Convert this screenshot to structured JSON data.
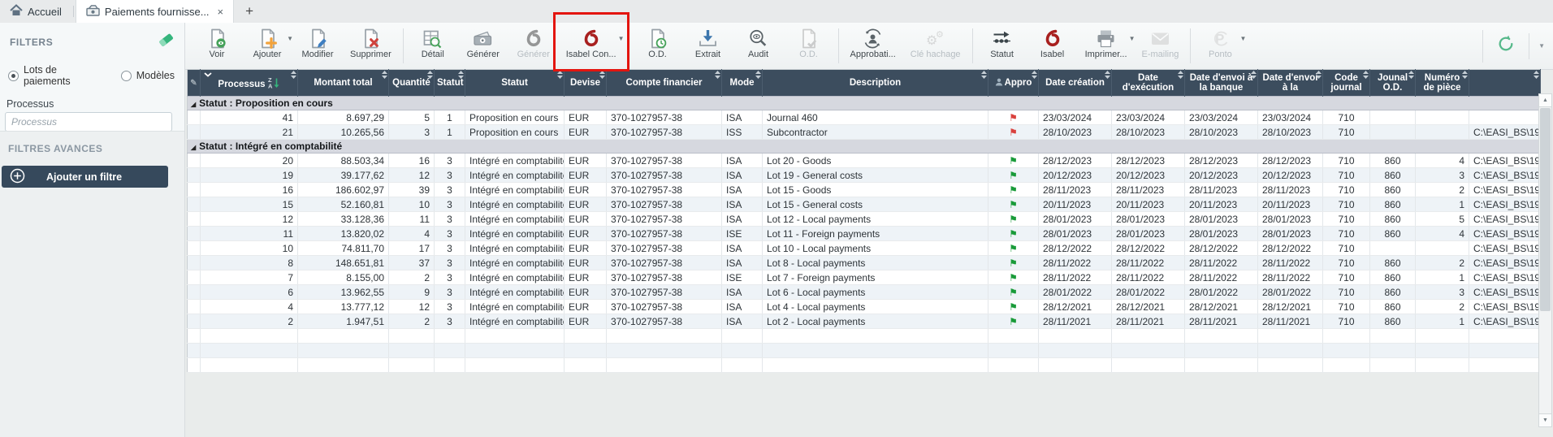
{
  "colors": {
    "annotation_red": "#e3150f",
    "flag_red": "#d9413d",
    "flag_green": "#199b39",
    "isabel_red": "#a8201f",
    "header_bg": "#3c4d5e",
    "sidebar_button_bg": "#36495c",
    "refresh_green": "#57b98b"
  },
  "tabs": {
    "home_label": "Accueil",
    "active_label": "Paiements fournisse...",
    "close_glyph": "×",
    "new_tab_glyph": "+"
  },
  "sidebar": {
    "title": "FILTERS",
    "radio_lots": "Lots de paiements",
    "radio_modeles": "Modèles",
    "processus_label": "Processus",
    "processus_placeholder": "Processus",
    "processus_value": "",
    "advanced_title": "FILTRES AVANCES",
    "add_filter_label": "Ajouter un filtre"
  },
  "toolbar": {
    "groups": [
      [
        {
          "name": "voir",
          "label": "Voir",
          "icon": "doc-eye",
          "enabled": true
        },
        {
          "name": "ajouter",
          "label": "Ajouter",
          "icon": "doc-plus",
          "enabled": true,
          "caret": true
        },
        {
          "name": "modifier",
          "label": "Modifier",
          "icon": "doc-pencil",
          "enabled": true
        },
        {
          "name": "supprimer",
          "label": "Supprimer",
          "icon": "doc-x",
          "enabled": true
        }
      ],
      [
        {
          "name": "detail",
          "label": "Détail",
          "icon": "grid-search",
          "enabled": true
        },
        {
          "name": "generer",
          "label": "Générer",
          "icon": "money",
          "enabled": true
        },
        {
          "name": "generer-isabel",
          "label": "Générer",
          "icon": "isabel-dark",
          "enabled": false
        },
        {
          "name": "isabel-connect",
          "label": "Isabel Con...",
          "icon": "isabel-red",
          "enabled": true,
          "caret": true,
          "highlighted": true
        }
      ],
      [
        {
          "name": "od",
          "label": "O.D.",
          "icon": "doc-clock",
          "enabled": true
        },
        {
          "name": "extrait",
          "label": "Extrait",
          "icon": "download",
          "enabled": true
        },
        {
          "name": "audit",
          "label": "Audit",
          "icon": "magnifier-eye",
          "enabled": true
        },
        {
          "name": "od-2",
          "label": "O.D.",
          "icon": "doc-check",
          "enabled": false
        }
      ],
      [
        {
          "name": "approbation",
          "label": "Approbati...",
          "icon": "person-sync",
          "enabled": true
        },
        {
          "name": "cle-hachage",
          "label": "Clé hachage",
          "icon": "gears",
          "enabled": false
        }
      ],
      [
        {
          "name": "statut",
          "label": "Statut",
          "icon": "flow-arrow",
          "enabled": true
        },
        {
          "name": "isabel",
          "label": "Isabel",
          "icon": "isabel-red",
          "enabled": true
        },
        {
          "name": "imprimer",
          "label": "Imprimer...",
          "icon": "printer",
          "enabled": true,
          "caret": true
        },
        {
          "name": "emailing",
          "label": "E-mailing",
          "icon": "envelope",
          "enabled": false
        }
      ],
      [
        {
          "name": "ponto",
          "label": "Ponto",
          "icon": "ponto",
          "enabled": false,
          "caret": true
        }
      ]
    ]
  },
  "table": {
    "columns": [
      {
        "name": "indicator",
        "label": ""
      },
      {
        "name": "processus",
        "label": "Processus"
      },
      {
        "name": "montant",
        "label": "Montant total"
      },
      {
        "name": "quantite",
        "label": "Quantité"
      },
      {
        "name": "statut_code",
        "label": "Statut"
      },
      {
        "name": "statut",
        "label": "Statut"
      },
      {
        "name": "devise",
        "label": "Devise"
      },
      {
        "name": "compte",
        "label": "Compte financier"
      },
      {
        "name": "mode",
        "label": "Mode"
      },
      {
        "name": "description",
        "label": "Description"
      },
      {
        "name": "appro",
        "label": "Appro"
      },
      {
        "name": "date_creation",
        "label": "Date création"
      },
      {
        "name": "date_execution",
        "label": "Date d'exécution"
      },
      {
        "name": "date_banque",
        "label": "Date d'envoi à la banque"
      },
      {
        "name": "date_envoi",
        "label": "Date d'envoi à la"
      },
      {
        "name": "code_journal",
        "label": "Code journal"
      },
      {
        "name": "jounal_od",
        "label": "Jounal O.D."
      },
      {
        "name": "piece",
        "label": "Numéro de pièce"
      },
      {
        "name": "path",
        "label": ""
      }
    ],
    "groups": [
      {
        "label": "Statut : Proposition en cours",
        "rows": [
          {
            "processus": "41",
            "montant": "8.697,29",
            "quantite": "5",
            "statut_code": "1",
            "statut": "Proposition en cours",
            "devise": "EUR",
            "compte": "370-1027957-38",
            "mode": "ISA",
            "description": "Journal 460",
            "flag": "red",
            "date": "23/03/2024",
            "code_journal": "710",
            "jounal_od": "",
            "piece": "",
            "path": ""
          },
          {
            "processus": "21",
            "montant": "10.265,56",
            "quantite": "3",
            "statut_code": "1",
            "statut": "Proposition en cours",
            "devise": "EUR",
            "compte": "370-1027957-38",
            "mode": "ISS",
            "description": "Subcontractor",
            "flag": "red",
            "date": "28/10/2023",
            "code_journal": "710",
            "jounal_od": "",
            "piece": "",
            "path": "C:\\EASI_BS\\19"
          }
        ]
      },
      {
        "label": "Statut : Intégré en comptabilité",
        "rows": [
          {
            "processus": "20",
            "montant": "88.503,34",
            "quantite": "16",
            "statut_code": "3",
            "statut": "Intégré en comptabilité",
            "devise": "EUR",
            "compte": "370-1027957-38",
            "mode": "ISA",
            "description": "Lot 20 - Goods",
            "flag": "green",
            "date": "28/12/2023",
            "code_journal": "710",
            "jounal_od": "860",
            "piece": "4",
            "path": "C:\\EASI_BS\\19"
          },
          {
            "processus": "19",
            "montant": "39.177,62",
            "quantite": "12",
            "statut_code": "3",
            "statut": "Intégré en comptabilité",
            "devise": "EUR",
            "compte": "370-1027957-38",
            "mode": "ISA",
            "description": "Lot 19 - General costs",
            "flag": "green",
            "date": "20/12/2023",
            "code_journal": "710",
            "jounal_od": "860",
            "piece": "3",
            "path": "C:\\EASI_BS\\19"
          },
          {
            "processus": "16",
            "montant": "186.602,97",
            "quantite": "39",
            "statut_code": "3",
            "statut": "Intégré en comptabilité",
            "devise": "EUR",
            "compte": "370-1027957-38",
            "mode": "ISA",
            "description": "Lot 15 - Goods",
            "flag": "green",
            "date": "28/11/2023",
            "code_journal": "710",
            "jounal_od": "860",
            "piece": "2",
            "path": "C:\\EASI_BS\\19"
          },
          {
            "processus": "15",
            "montant": "52.160,81",
            "quantite": "10",
            "statut_code": "3",
            "statut": "Intégré en comptabilité",
            "devise": "EUR",
            "compte": "370-1027957-38",
            "mode": "ISA",
            "description": "Lot 15 - General costs",
            "flag": "green",
            "date": "20/11/2023",
            "code_journal": "710",
            "jounal_od": "860",
            "piece": "1",
            "path": "C:\\EASI_BS\\19"
          },
          {
            "processus": "12",
            "montant": "33.128,36",
            "quantite": "11",
            "statut_code": "3",
            "statut": "Intégré en comptabilité",
            "devise": "EUR",
            "compte": "370-1027957-38",
            "mode": "ISA",
            "description": "Lot 12 - Local payments",
            "flag": "green",
            "date": "28/01/2023",
            "code_journal": "710",
            "jounal_od": "860",
            "piece": "5",
            "path": "C:\\EASI_BS\\19"
          },
          {
            "processus": "11",
            "montant": "13.820,02",
            "quantite": "4",
            "statut_code": "3",
            "statut": "Intégré en comptabilité",
            "devise": "EUR",
            "compte": "370-1027957-38",
            "mode": "ISE",
            "description": "Lot 11 - Foreign payments",
            "flag": "green",
            "date": "28/01/2023",
            "code_journal": "710",
            "jounal_od": "860",
            "piece": "4",
            "path": "C:\\EASI_BS\\19"
          },
          {
            "processus": "10",
            "montant": "74.811,70",
            "quantite": "17",
            "statut_code": "3",
            "statut": "Intégré en comptabilité",
            "devise": "EUR",
            "compte": "370-1027957-38",
            "mode": "ISA",
            "description": "Lot 10 - Local payments",
            "flag": "green",
            "date": "28/12/2022",
            "code_journal": "710",
            "jounal_od": "",
            "piece": "",
            "path": "C:\\EASI_BS\\19"
          },
          {
            "processus": "8",
            "montant": "148.651,81",
            "quantite": "37",
            "statut_code": "3",
            "statut": "Intégré en comptabilité",
            "devise": "EUR",
            "compte": "370-1027957-38",
            "mode": "ISA",
            "description": "Lot 8 - Local payments",
            "flag": "green",
            "date": "28/11/2022",
            "code_journal": "710",
            "jounal_od": "860",
            "piece": "2",
            "path": "C:\\EASI_BS\\19"
          },
          {
            "processus": "7",
            "montant": "8.155,00",
            "quantite": "2",
            "statut_code": "3",
            "statut": "Intégré en comptabilité",
            "devise": "EUR",
            "compte": "370-1027957-38",
            "mode": "ISE",
            "description": "Lot 7 - Foreign payments",
            "flag": "green",
            "date": "28/11/2022",
            "code_journal": "710",
            "jounal_od": "860",
            "piece": "1",
            "path": "C:\\EASI_BS\\19"
          },
          {
            "processus": "6",
            "montant": "13.962,55",
            "quantite": "9",
            "statut_code": "3",
            "statut": "Intégré en comptabilité",
            "devise": "EUR",
            "compte": "370-1027957-38",
            "mode": "ISA",
            "description": "Lot 6 - Local payments",
            "flag": "green",
            "date": "28/01/2022",
            "code_journal": "710",
            "jounal_od": "860",
            "piece": "3",
            "path": "C:\\EASI_BS\\19"
          },
          {
            "processus": "4",
            "montant": "13.777,12",
            "quantite": "12",
            "statut_code": "3",
            "statut": "Intégré en comptabilité",
            "devise": "EUR",
            "compte": "370-1027957-38",
            "mode": "ISA",
            "description": "Lot 4 - Local payments",
            "flag": "green",
            "date": "28/12/2021",
            "code_journal": "710",
            "jounal_od": "860",
            "piece": "2",
            "path": "C:\\EASI_BS\\19"
          },
          {
            "processus": "2",
            "montant": "1.947,51",
            "quantite": "2",
            "statut_code": "3",
            "statut": "Intégré en comptabilité",
            "devise": "EUR",
            "compte": "370-1027957-38",
            "mode": "ISA",
            "description": "Lot 2 - Local payments",
            "flag": "green",
            "date": "28/11/2021",
            "code_journal": "710",
            "jounal_od": "860",
            "piece": "1",
            "path": "C:\\EASI_BS\\19"
          }
        ]
      }
    ]
  }
}
